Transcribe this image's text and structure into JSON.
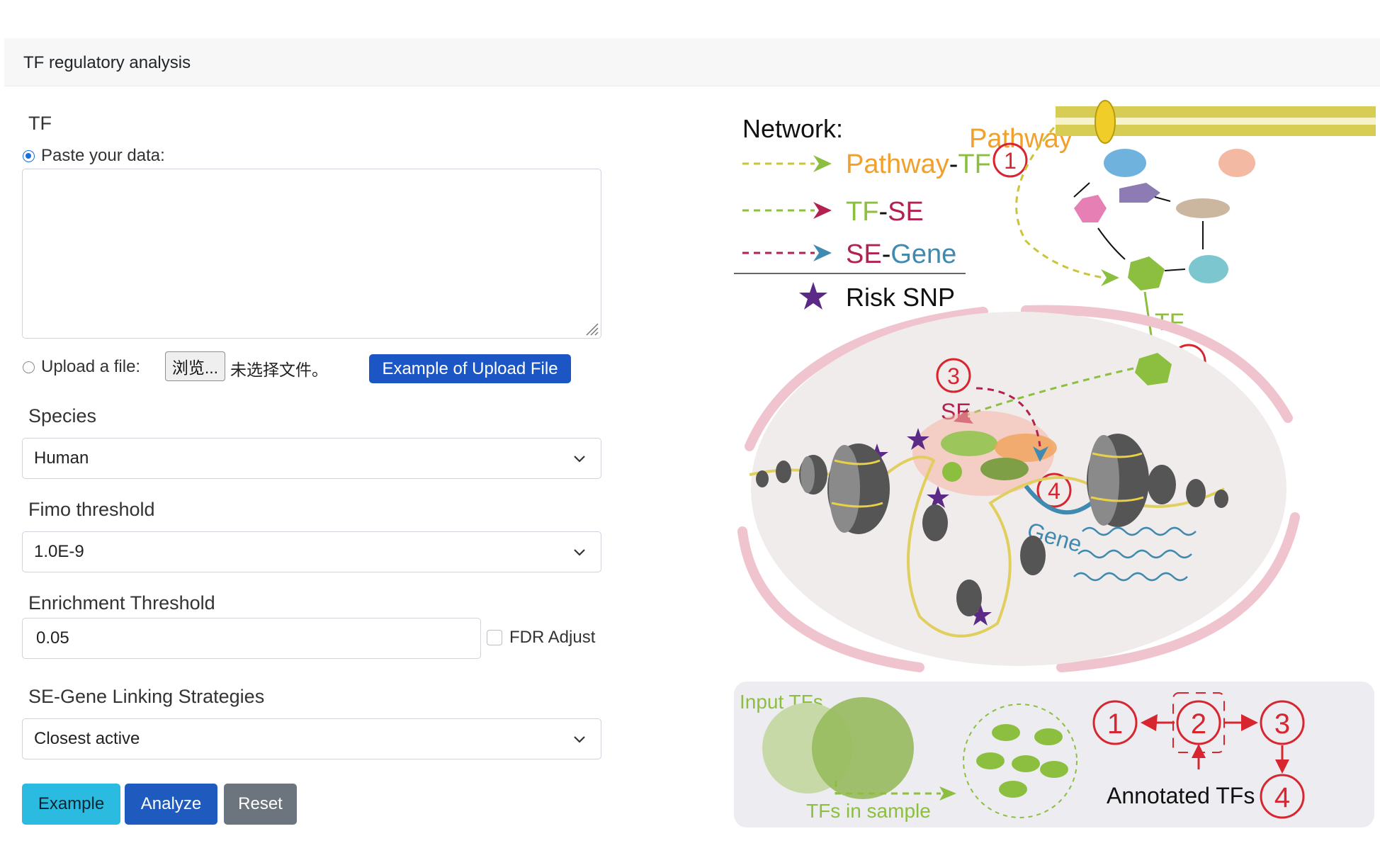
{
  "header": {
    "title": "TF regulatory analysis"
  },
  "tf_section": {
    "label": "TF",
    "paste_option_label": "Paste your data:",
    "paste_value": "",
    "upload_option_label": "Upload a file:",
    "browse_button_label": "浏览...",
    "file_status": "未选择文件。",
    "example_upload_button_label": "Example of Upload File"
  },
  "species": {
    "label": "Species",
    "selected": "Human"
  },
  "fimo": {
    "label": "Fimo threshold",
    "selected": "1.0E-9"
  },
  "enrichment": {
    "label": "Enrichment Threshold",
    "value": "0.05",
    "fdr_label": "FDR Adjust"
  },
  "linking": {
    "label": "SE-Gene Linking Strategies",
    "selected": "Closest active"
  },
  "actions": {
    "example_label": "Example",
    "analyze_label": "Analyze",
    "reset_label": "Reset"
  },
  "figure": {
    "network_title": "Network:",
    "legend": [
      {
        "prefix": "Pathway",
        "sep": "-",
        "suffix": "TF",
        "arrow_color": "#8cbf3f"
      },
      {
        "prefix": "TF",
        "sep": "-",
        "suffix": "SE",
        "arrow_color": "#b3224e"
      },
      {
        "prefix": "SE",
        "sep": "-",
        "suffix": "Gene",
        "arrow_color": "#3f8ab0"
      }
    ],
    "risk_snp_label": "Risk SNP",
    "pathway_label": "Pathway",
    "tf_label": "TF",
    "se_label": "SE",
    "gene_label": "Gene",
    "input_tfs_label": "Input TFs",
    "tfs_in_sample_label": "TFs in sample",
    "annotated_tfs_label": "Annotated TFs",
    "step_numbers": [
      "1",
      "2",
      "3",
      "4"
    ],
    "colors": {
      "pathway_orange": "#f0a02b",
      "tf_green": "#8cbf3f",
      "se_red": "#b3224e",
      "gene_blue": "#3f8ab0",
      "circle_red": "#d7262f",
      "snp_purple": "#5b2a86"
    }
  }
}
